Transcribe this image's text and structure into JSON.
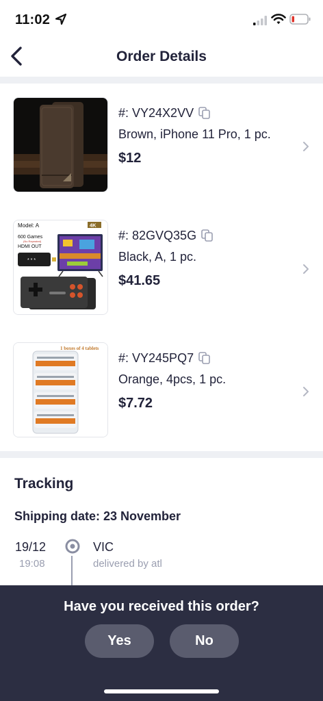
{
  "status_bar": {
    "time": "11:02",
    "icons": [
      "location-arrow-icon",
      "signal-icon",
      "wifi-icon",
      "battery-low-icon"
    ]
  },
  "header": {
    "title": "Order Details",
    "back_icon": "chevron-left-icon"
  },
  "items": [
    {
      "order_no": "#: VY24X2VV",
      "description": "Brown, iPhone 11 Pro, 1 pc.",
      "price": "$12"
    },
    {
      "order_no": "#: 82GVQ35G",
      "description": "Black, A, 1 pc.",
      "price": "$41.65"
    },
    {
      "order_no": "#: VY245PQ7",
      "description": "Orange, 4pcs, 1 pc.",
      "price": "$7.72"
    }
  ],
  "product_images": {
    "console": {
      "model": "Model: A",
      "games": "600 Games",
      "sub": "(No Repeated)",
      "hdmi": "HDMI OUT",
      "badge": "4K",
      "stars": "* * *"
    },
    "razor": {
      "banner": "1 boxes of 4 tablets"
    }
  },
  "tracking": {
    "title": "Tracking",
    "shipping_date": "Shipping date: 23 November",
    "events": [
      {
        "date": "19/12",
        "time": "19:08",
        "location": "VIC",
        "carrier": "delivered by atl"
      }
    ]
  },
  "confirm_sheet": {
    "question": "Have you received this order?",
    "yes_label": "Yes",
    "no_label": "No"
  },
  "colors": {
    "text_primary": "#22233a",
    "text_secondary": "#9a9eb0",
    "sheet_bg": "#2c2e42",
    "button_bg": "#5a5c6e",
    "divider": "#eef0f4",
    "battery_low": "#e0342b"
  }
}
